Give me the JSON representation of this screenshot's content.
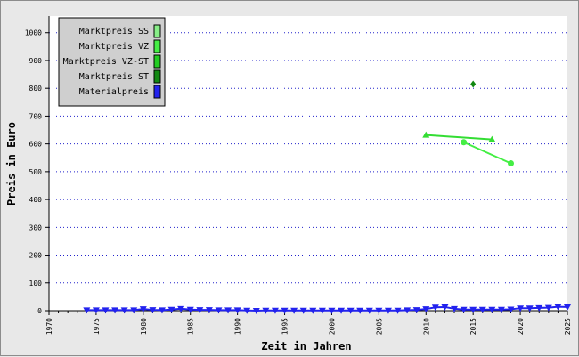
{
  "chart_data": {
    "type": "line",
    "xlabel": "Zeit in Jahren",
    "ylabel": "Preis in Euro",
    "xlim": [
      1970,
      2025
    ],
    "ylim": [
      0,
      1060
    ],
    "x_ticks": [
      1970,
      1975,
      1980,
      1985,
      1990,
      1995,
      2000,
      2005,
      2010,
      2015,
      2020,
      2025
    ],
    "y_ticks": [
      0,
      100,
      200,
      300,
      400,
      500,
      600,
      700,
      800,
      900,
      1000
    ],
    "grid": "horizontal dotted",
    "legend_position": "top-left",
    "legend": [
      {
        "name": "Marktpreis SS",
        "color": "#88ee88"
      },
      {
        "name": "Marktpreis VZ",
        "color": "#44ee44"
      },
      {
        "name": "Marktpreis VZ-ST",
        "color": "#22cc22"
      },
      {
        "name": "Marktpreis ST",
        "color": "#118811"
      },
      {
        "name": "Materialpreis",
        "color": "#2222ee"
      }
    ],
    "series": [
      {
        "name": "Marktpreis VZ",
        "color": "#33dd33",
        "marker": "triangle-up",
        "points": [
          [
            2010,
            632
          ],
          [
            2017,
            616
          ]
        ]
      },
      {
        "name": "Marktpreis VZ",
        "color": "#44ee44",
        "marker": "circle",
        "points": [
          [
            2014,
            606
          ],
          [
            2019,
            530
          ]
        ]
      },
      {
        "name": "Marktpreis ST",
        "color": "#118811",
        "marker": "diamond",
        "points": [
          [
            2015,
            815
          ]
        ]
      },
      {
        "name": "Materialpreis",
        "color": "#2222ee",
        "marker": "triangle-down",
        "points": [
          [
            1974,
            2
          ],
          [
            1975,
            2
          ],
          [
            1976,
            2
          ],
          [
            1977,
            2
          ],
          [
            1978,
            2
          ],
          [
            1979,
            2
          ],
          [
            1980,
            6
          ],
          [
            1981,
            3
          ],
          [
            1982,
            2
          ],
          [
            1983,
            4
          ],
          [
            1984,
            7
          ],
          [
            1985,
            4
          ],
          [
            1986,
            3
          ],
          [
            1987,
            3
          ],
          [
            1988,
            2
          ],
          [
            1989,
            2
          ],
          [
            1990,
            2
          ],
          [
            1991,
            1
          ],
          [
            1992,
            0
          ],
          [
            1993,
            1
          ],
          [
            1994,
            1
          ],
          [
            1995,
            1
          ],
          [
            1996,
            1
          ],
          [
            1997,
            1
          ],
          [
            1998,
            1
          ],
          [
            1999,
            1
          ],
          [
            2000,
            1
          ],
          [
            2001,
            1
          ],
          [
            2002,
            1
          ],
          [
            2003,
            1
          ],
          [
            2004,
            1
          ],
          [
            2005,
            1
          ],
          [
            2006,
            1
          ],
          [
            2007,
            1
          ],
          [
            2008,
            2
          ],
          [
            2009,
            3
          ],
          [
            2010,
            6
          ],
          [
            2011,
            12
          ],
          [
            2012,
            13
          ],
          [
            2013,
            7
          ],
          [
            2014,
            4
          ],
          [
            2015,
            4
          ],
          [
            2016,
            4
          ],
          [
            2017,
            4
          ],
          [
            2018,
            4
          ],
          [
            2019,
            5
          ],
          [
            2020,
            9
          ],
          [
            2021,
            9
          ],
          [
            2022,
            10
          ],
          [
            2023,
            11
          ],
          [
            2024,
            14
          ],
          [
            2025,
            13
          ]
        ]
      }
    ]
  }
}
